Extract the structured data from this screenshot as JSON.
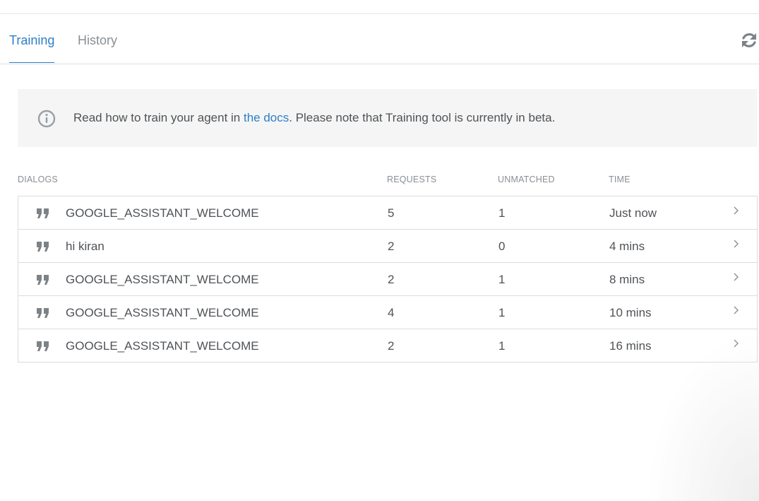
{
  "tabs": [
    {
      "label": "Training",
      "active": true
    },
    {
      "label": "History",
      "active": false
    }
  ],
  "toolbar": {
    "refresh_icon": "refresh-icon"
  },
  "info": {
    "icon": "info-icon",
    "prefix": "Read how to train your agent in ",
    "link_text": "the docs",
    "suffix": ". Please note that Training tool is currently in beta."
  },
  "table": {
    "columns": [
      "DIALOGS",
      "REQUESTS",
      "UNMATCHED",
      "TIME"
    ],
    "rows": [
      {
        "dialog": "GOOGLE_ASSISTANT_WELCOME",
        "requests": "5",
        "unmatched": "1",
        "time": "Just now"
      },
      {
        "dialog": "hi kiran",
        "requests": "2",
        "unmatched": "0",
        "time": "4 mins"
      },
      {
        "dialog": "GOOGLE_ASSISTANT_WELCOME",
        "requests": "2",
        "unmatched": "1",
        "time": "8 mins"
      },
      {
        "dialog": "GOOGLE_ASSISTANT_WELCOME",
        "requests": "4",
        "unmatched": "1",
        "time": "10 mins"
      },
      {
        "dialog": "GOOGLE_ASSISTANT_WELCOME",
        "requests": "2",
        "unmatched": "1",
        "time": "16 mins"
      }
    ]
  },
  "colors": {
    "accent": "#2c7fc7",
    "text": "#4f5357",
    "muted": "#8a8f94",
    "border": "#dadce0",
    "info_bg": "#f5f5f5"
  }
}
